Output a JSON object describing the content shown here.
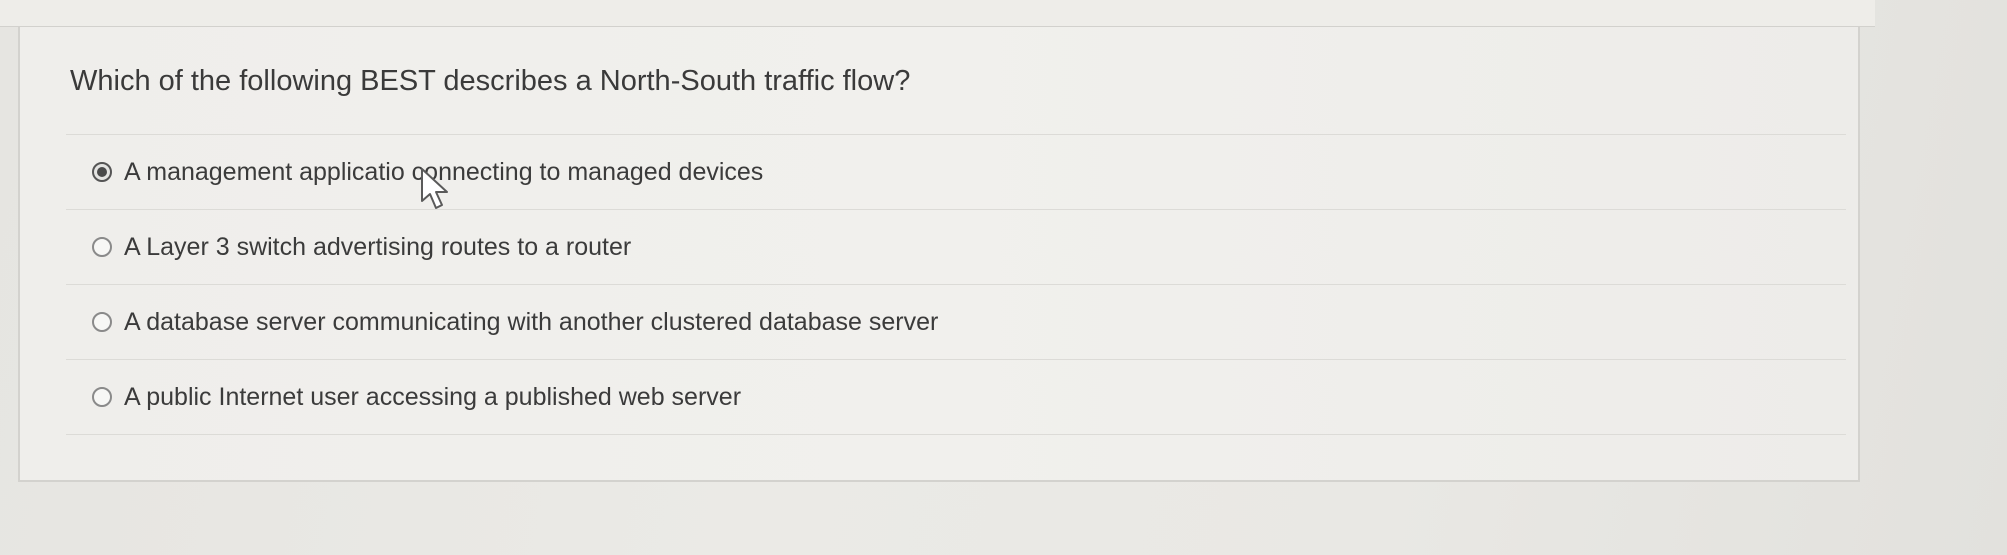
{
  "question": {
    "text": "Which of the following BEST describes a North-South traffic flow?"
  },
  "options": [
    {
      "label": "A management applicatio  connecting to managed devices",
      "selected": true
    },
    {
      "label": "A Layer 3 switch advertising routes to a router",
      "selected": false
    },
    {
      "label": "A database server communicating with another clustered database server",
      "selected": false
    },
    {
      "label": "A public Internet user accessing a published web server",
      "selected": false
    }
  ],
  "icons": {
    "cursor": "mouse-pointer-icon",
    "radio": "radio-button-icon"
  }
}
